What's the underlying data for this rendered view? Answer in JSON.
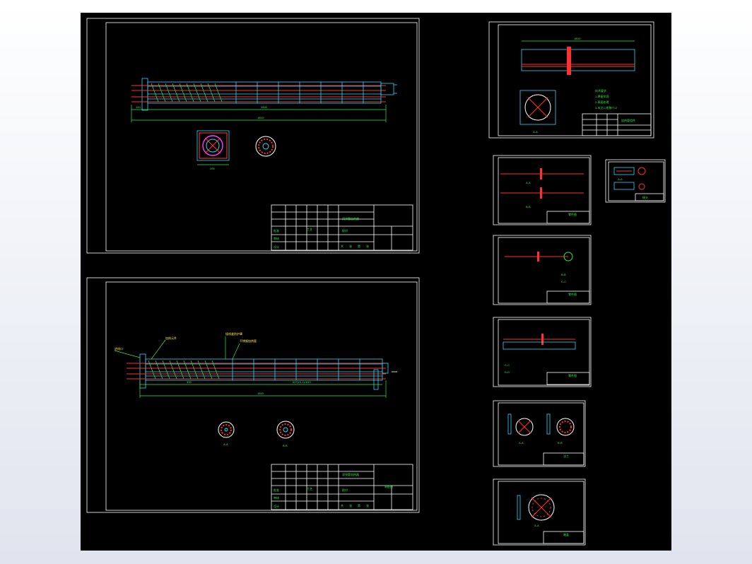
{
  "drawing": {
    "background": "#000000",
    "colors": {
      "frame": "#ffffff",
      "dimension": "#35e84a",
      "outline": "#2fd8ff",
      "heater": "#ff3030",
      "note": "#ffe94a"
    }
  },
  "sheet_main_1": {
    "dim_total": "1800",
    "dim_sub": "1500",
    "dim_left": "100",
    "section_dim": "200",
    "title_block": {
      "title": "双排管加热器",
      "cells": [
        "批准",
        "审核",
        "设计",
        "工艺",
        "校对",
        "共",
        "张",
        "第",
        "张"
      ]
    }
  },
  "sheet_main_2": {
    "annotations": [
      "加热元件",
      "不锈钢加热管",
      "接线盒防护罩",
      "进线口"
    ],
    "dim_total": "1800",
    "dim_sub": "300",
    "dim_pitch": "60*(15-1)=840",
    "section_labels": [
      "A-A",
      "B-B"
    ],
    "title_block": {
      "title": "双排管加热器",
      "subtitle": "装配图",
      "cells": [
        "批准",
        "审核",
        "设计",
        "工艺",
        "校对",
        "共",
        "张",
        "第",
        "张"
      ]
    }
  },
  "sheet_part_1": {
    "dim_top": "1800",
    "labels": [
      "A-A"
    ],
    "notes": [
      "技术要求",
      "1.焊接牢固",
      "2.表面处理",
      "3.未注公差按IT12"
    ],
    "title_block": {
      "title": "加热管组件"
    }
  },
  "sheet_part_2": {
    "labels": [
      "A-A",
      "B-B"
    ],
    "title_block": {
      "title": "零件图"
    }
  },
  "sheet_part_3": {
    "labels": [
      "B-B",
      "C-C"
    ],
    "title_block": {
      "title": "零件图"
    }
  },
  "sheet_part_4": {
    "labels": [
      "C-C",
      "D-D"
    ],
    "title_block": {
      "title": "零件图"
    }
  },
  "sheet_part_5": {
    "labels": [
      "A-A",
      "B-B"
    ],
    "title_block": {
      "title": "法兰"
    }
  },
  "sheet_part_6": {
    "labels": [
      "A-A"
    ],
    "title_block": {
      "title": "端盖"
    }
  },
  "sheet_small": {
    "labels": [
      "A-A"
    ],
    "title_block": {
      "title": "接头"
    }
  }
}
